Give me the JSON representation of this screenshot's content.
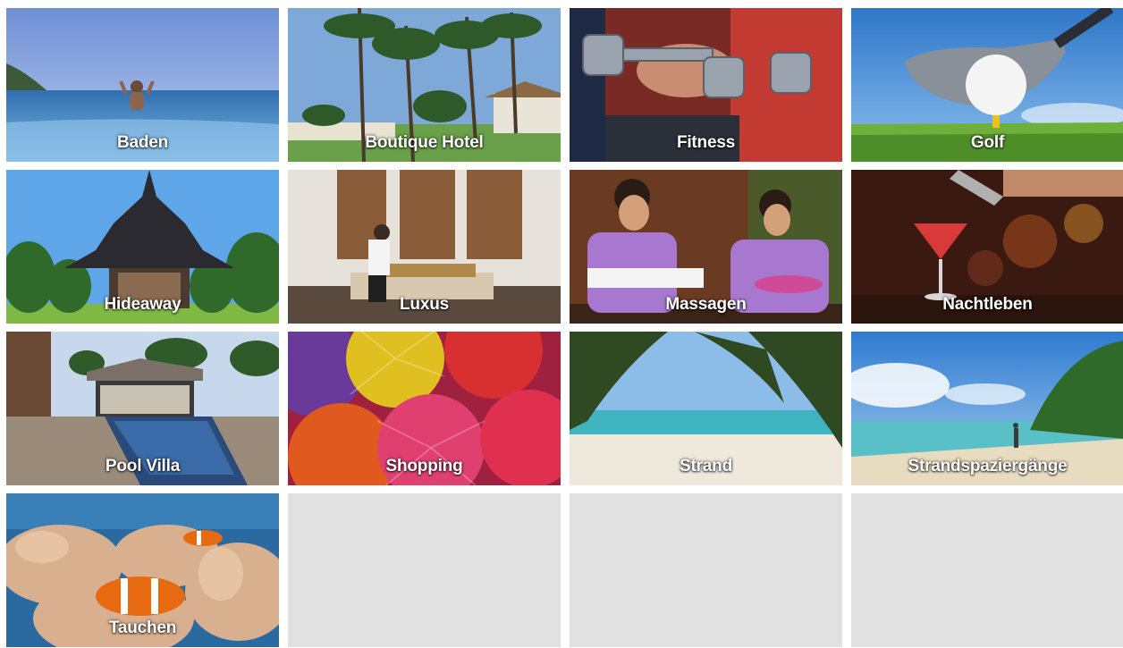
{
  "tiles": [
    {
      "label": "Baden",
      "image": "infinity-pool-sea"
    },
    {
      "label": "Boutique Hotel",
      "image": "palm-beach-resort"
    },
    {
      "label": "Fitness",
      "image": "dumbbells"
    },
    {
      "label": "Golf",
      "image": "golf-ball-driver"
    },
    {
      "label": "Hideaway",
      "image": "thai-pavilion"
    },
    {
      "label": "Luxus",
      "image": "luxury-bedroom"
    },
    {
      "label": "Massagen",
      "image": "spa-therapists"
    },
    {
      "label": "Nachtleben",
      "image": "cocktail-bar"
    },
    {
      "label": "Pool Villa",
      "image": "villa-pool"
    },
    {
      "label": "Shopping",
      "image": "paper-umbrellas"
    },
    {
      "label": "Strand",
      "image": "tropical-beach"
    },
    {
      "label": "Strandspaziergänge",
      "image": "beach-walk"
    },
    {
      "label": "Tauchen",
      "image": "clownfish-anemone"
    }
  ],
  "colors": {
    "empty_tile": "#e1e1e1",
    "label_text": "#ffffff"
  }
}
